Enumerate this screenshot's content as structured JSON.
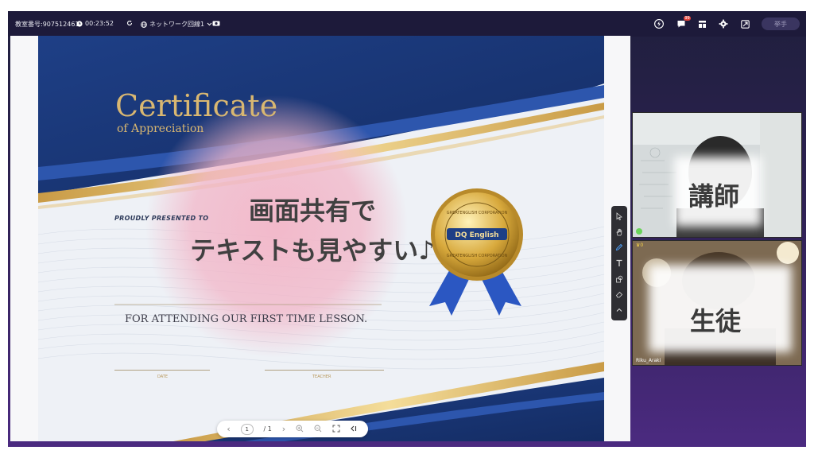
{
  "topbar": {
    "classroom_number": "教室番号:907512461",
    "timer": "00:23:52",
    "network_label": "ネットワーク回線1",
    "raise_hand": "挙手",
    "chat_badge": "99"
  },
  "certificate": {
    "title": "Certificate",
    "subtitle": "of Appreciation",
    "proudly": "PROUDLY PRESENTED TO",
    "attending": "FOR ATTENDING OUR FIRST TIME LESSON.",
    "date_label": "DATE",
    "teacher_label": "TEACHER",
    "medal_text": "DQ English",
    "medal_ring_top": "GREATENGLISH CORPORATION",
    "medal_ring_bottom": "GREATENGLISH CORPORATION"
  },
  "caption": {
    "line1": "画面共有で",
    "line2": "テキストも見やすい♪"
  },
  "pager": {
    "current_page": "1",
    "total_pages": "/ 1"
  },
  "videos": {
    "teacher_label": "講師",
    "student_label": "生徒",
    "student_name": "Riku_Araki",
    "student_count": "0"
  },
  "colors": {
    "navy": "#1c3a78",
    "gold": "#d9b771",
    "pink_glow": "#f2b6c8",
    "app_bg": "#2e2153"
  }
}
